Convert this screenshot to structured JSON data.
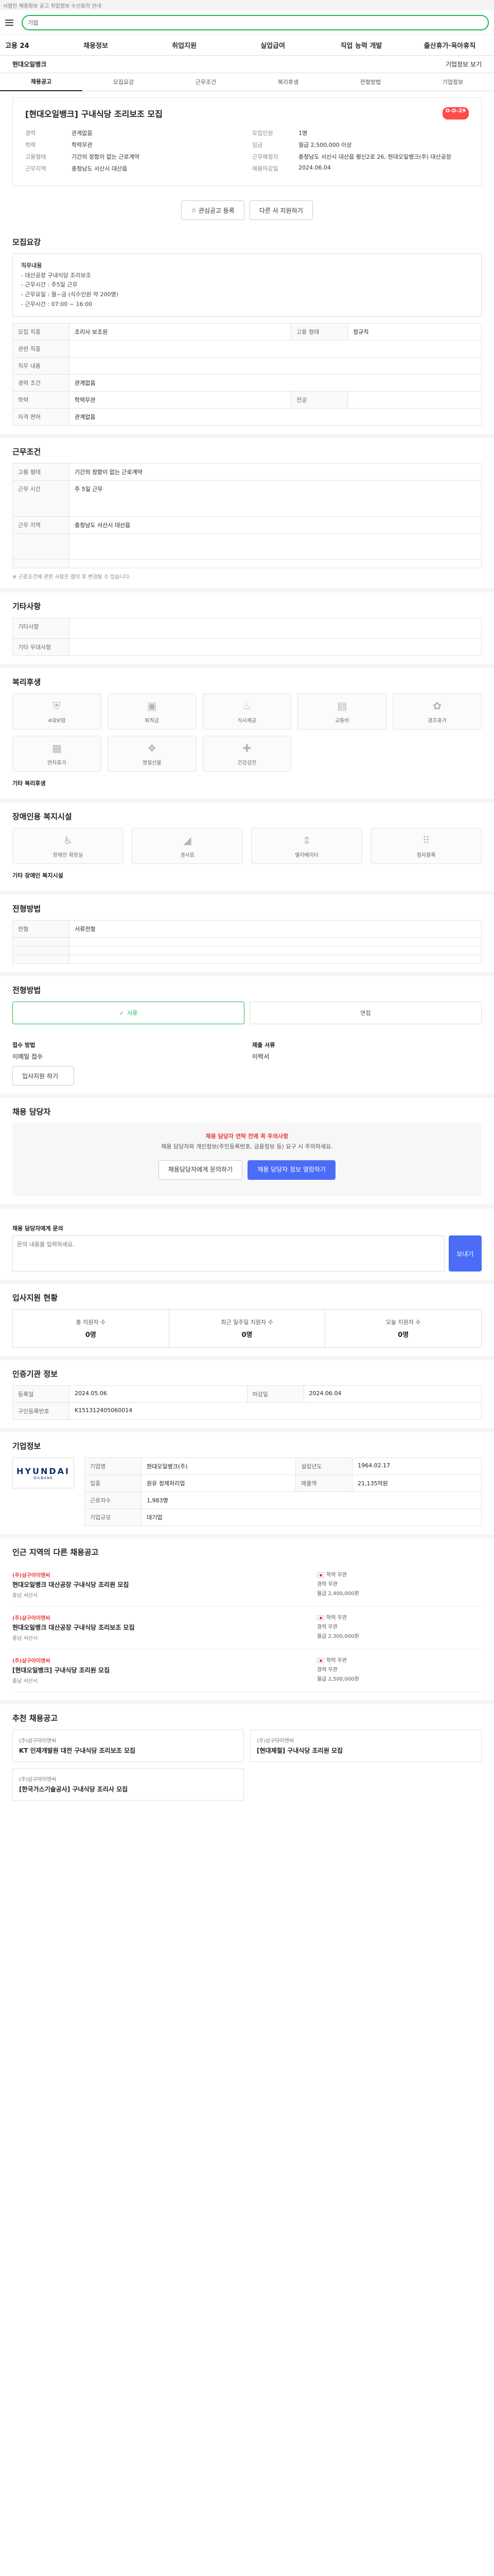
{
  "topbanner": {
    "text": "사람인 채용정보 공고 취업정보 수신동의 안내"
  },
  "header": {
    "search_placeholder": "기업"
  },
  "gnb": {
    "logo": "고용 24",
    "items": [
      "채용정보",
      "취업지원",
      "실업급여",
      "직업 능력 개발",
      "출산휴가·육아휴직"
    ]
  },
  "company": {
    "name": "현대오일뱅크",
    "action": "기업정보 보기"
  },
  "tabs": [
    "채용공고",
    "모집요강",
    "근무조건",
    "복리후생",
    "전형방법",
    "기업정보"
  ],
  "job": {
    "title": "[현대오일뱅크] 구내식당 조리보조 모집",
    "dday": "D-D-29",
    "left": [
      [
        "경력",
        "관계없음"
      ],
      [
        "학력",
        "학력무관"
      ],
      [
        "",
        ""
      ],
      [
        "고용형태",
        "기간의 정함이 없는 근로계약"
      ],
      [
        "근무지역",
        "충청남도 서산시 대산읍"
      ]
    ],
    "right": [
      [
        "모집인원",
        "1명"
      ],
      [
        "임금",
        "월급 2,500,000 이상"
      ],
      [
        "근무예정지",
        "충청남도 서산시 대산읍 평신2로 26, 현대오일뱅크(주) 대산공장"
      ],
      [
        "",
        ""
      ],
      [
        "채용마감일",
        "2024.06.04"
      ]
    ],
    "buttons": [
      "관심공고 등록",
      "다른 사 지원하기"
    ]
  },
  "recruit": {
    "title": "모집요강",
    "box": [
      "직무내용",
      "- 대산공장 구내식당 조리보조",
      "- 근무시간 : 주5일 근무",
      "- 근무요일 : 월~금 (식수인원 약 200명)",
      "- 근무시간 : 07:00 ~ 16:00"
    ],
    "rows": [
      [
        "모집 직종",
        "조리사 보조원",
        "고용 형태",
        "정규직"
      ],
      [
        "관련 직종",
        "",
        "",
        ""
      ],
      [
        "직무 내용",
        "",
        "",
        ""
      ],
      [
        "경력 조건",
        "관계없음",
        "",
        ""
      ],
      [
        "학력",
        "학력무관",
        "전공",
        ""
      ],
      [
        "자격 면허",
        "관계없음",
        "",
        ""
      ]
    ]
  },
  "conditions": {
    "title": "근무조건",
    "rows": [
      [
        "고용 형태",
        "기간의 정함이 없는 근로계약",
        "",
        ""
      ],
      [
        "근무 시간",
        "주 5일 근무",
        "",
        ""
      ],
      [
        "근무 지역",
        "충청남도 서산시 대산읍",
        "",
        ""
      ],
      [
        "",
        "",
        "",
        ""
      ],
      [
        "",
        "",
        "",
        ""
      ]
    ],
    "notice": "※ 근로조건에 관한 사항은 협의 후 변경될 수 있습니다."
  },
  "etc": {
    "title": "기타사항",
    "items": [
      "기타사항",
      "기타 우대사항"
    ]
  },
  "welfare": {
    "title": "복리후생",
    "icons": [
      "4대보험",
      "퇴직금",
      "식사제공",
      "교통비",
      "경조휴가",
      "연차휴가",
      "명절선물",
      "건강검진"
    ],
    "more": "기타 복리후생"
  },
  "disabled": {
    "title": "장애인용 복지시설",
    "icons": [
      "장애인 화장실",
      "경사로",
      "엘리베이터",
      "점자블록"
    ],
    "more": "기타 장애인 복지시설"
  },
  "selection": {
    "title": "전형방법",
    "rows": [
      [
        "전형",
        "서류전형"
      ],
      [
        "",
        ""
      ],
      [
        "",
        ""
      ],
      [
        "",
        ""
      ],
      [
        "",
        ""
      ]
    ]
  },
  "apply": {
    "title": "전형방법",
    "opts": [
      "서류",
      "면접"
    ],
    "method_label": "접수 방법",
    "method": "이메일 접수",
    "docs_label": "제출 서류",
    "docs": "이력서",
    "button": "입사지원 하기"
  },
  "warn": {
    "title": "채용 담당자",
    "red": "채용 담당자 연락 전에 꼭 주의사항",
    "text": "채용 담당자와 개인정보(주민등록번호, 금융정보 등) 요구 시 주의하세요.",
    "btn1": "채용담당자에게 문의하기",
    "btn2": "채용 담당자 정보 열람하기"
  },
  "inquiry": {
    "title": "채용 담당자에게 문의",
    "placeholder": "문의 내용을 입력하세요.",
    "button": "보내기"
  },
  "applystats": {
    "title": "입사지원 현황",
    "items": [
      [
        "총 지원자 수",
        "0명"
      ],
      [
        "최근 일주일 지원자 수",
        "0명"
      ],
      [
        "오늘 지원자 수",
        "0명"
      ]
    ]
  },
  "hrinfo": {
    "title": "인증기관 정보",
    "rows": [
      [
        "등록일",
        "2024.05.06",
        "마감일",
        "2024.06.04"
      ],
      [
        "구인등록번호",
        "K151312405060014",
        "",
        ""
      ]
    ]
  },
  "companyinfo": {
    "title": "기업정보",
    "logo_main": "HYUNDAI",
    "logo_sub": "OILBANK",
    "rows": [
      [
        "기업명",
        "현대오일뱅크(주)",
        "설립년도",
        "1964.02.17"
      ],
      [
        "업종",
        "원유 정제처리업",
        "매출액",
        "21,135억원"
      ],
      [
        "근로자수",
        "1,983명",
        "",
        ""
      ],
      [
        "기업규모",
        "대기업",
        "",
        ""
      ]
    ]
  },
  "similar": {
    "title": "인근 지역의 다른 채용공고",
    "items": [
      {
        "name": "(주)삼구아이앤씨",
        "title": "현대오일뱅크 대산공장 구내식당 조리원 모집",
        "meta": "충남 서산시",
        "right": [
          "학력 무관",
          "경력 무관",
          "월급 2,400,000원"
        ]
      },
      {
        "name": "(주)삼구아이앤씨",
        "title": "현대오일뱅크 대산공장 구내식당 조리보조 모집",
        "meta": "충남 서산시",
        "right": [
          "학력 무관",
          "경력 무관",
          "월급 2,300,000원"
        ]
      },
      {
        "name": "(주)삼구아이앤씨",
        "title": "[현대오일뱅크] 구내식당 조리원 모집",
        "meta": "충남 서산시",
        "right": [
          "학력 무관",
          "경력 무관",
          "월급 2,500,000원"
        ]
      }
    ]
  },
  "recommend": {
    "title": "추천 채용공고",
    "cards": [
      {
        "name": "(주)삼구아이앤씨",
        "title": "KT 인재개발원 대전 구내식당 조리보조 모집"
      },
      {
        "name": "(주)삼구아이앤씨",
        "title": "[현대제철] 구내식당 조리원 모집"
      },
      {
        "name": "(주)삼구아이앤씨",
        "title": "[한국가스기술공사] 구내식당 조리사 모집"
      }
    ]
  }
}
